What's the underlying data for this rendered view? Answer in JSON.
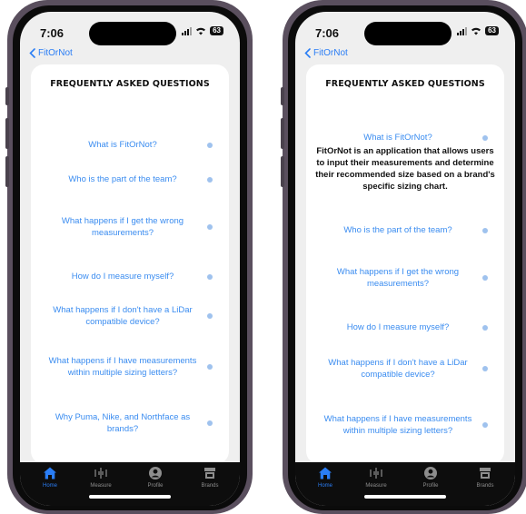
{
  "phones": [
    {
      "status": {
        "time": "7:06",
        "battery": "63"
      },
      "nav": {
        "back_label": "FitOrNot"
      },
      "faq": {
        "title": "FREQUENTLY ASKED QUESTIONS",
        "questions": [
          "What is FitOrNot?",
          "Who is the part of the team?",
          "What happens if I get the wrong measurements?",
          "How do I measure myself?",
          "What happens if I don't have a LiDar compatible device?",
          "What happens if I have measurements within multiple sizing letters?",
          "Why Puma, Nike, and Northface as brands?"
        ]
      },
      "tabs": [
        {
          "label": "Home",
          "icon": "house-icon",
          "active": true
        },
        {
          "label": "Measure",
          "icon": "measure-icon",
          "active": false
        },
        {
          "label": "Profile",
          "icon": "person-icon",
          "active": false
        },
        {
          "label": "Brands",
          "icon": "storefront-icon",
          "active": false
        }
      ]
    },
    {
      "status": {
        "time": "7:06",
        "battery": "63"
      },
      "nav": {
        "back_label": "FitOrNot"
      },
      "faq": {
        "title": "FREQUENTLY ASKED QUESTIONS",
        "questions": [
          "What is FitOrNot?",
          "Who is the part of the team?",
          "What happens if I get the wrong measurements?",
          "How do I measure myself?",
          "What happens if I don't have a LiDar compatible device?",
          "What happens if I have measurements within multiple sizing letters?"
        ],
        "expanded_answer": "FitOrNot is an application that allows users to input their measurements and determine their recommended size based on a brand's specific sizing chart."
      },
      "tabs": [
        {
          "label": "Home",
          "icon": "house-icon",
          "active": true
        },
        {
          "label": "Measure",
          "icon": "measure-icon",
          "active": false
        },
        {
          "label": "Profile",
          "icon": "person-icon",
          "active": false
        },
        {
          "label": "Brands",
          "icon": "storefront-icon",
          "active": false
        }
      ]
    }
  ],
  "colors": {
    "accent": "#2a7df5",
    "question_text": "#3a8cf0",
    "tabbar_bg": "#0d0d0d",
    "phone_frame": "#5a4f5e"
  }
}
